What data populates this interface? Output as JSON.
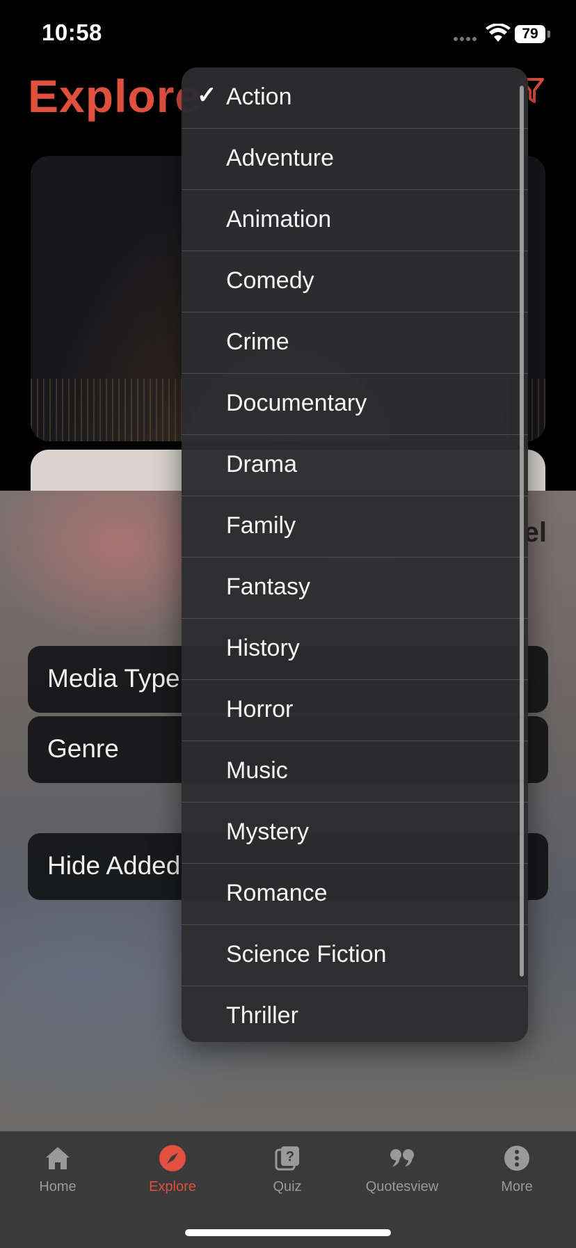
{
  "status_bar": {
    "time": "10:58",
    "battery": "79"
  },
  "page": {
    "title": "Explore"
  },
  "sheet": {
    "cancel_label": "el",
    "rows": {
      "media_type": "Media Type",
      "genre": "Genre",
      "hide_added": "Hide Added"
    }
  },
  "dropdown": {
    "selected": "Action",
    "check_glyph": "✓",
    "items": [
      "Action",
      "Adventure",
      "Animation",
      "Comedy",
      "Crime",
      "Documentary",
      "Drama",
      "Family",
      "Fantasy",
      "History",
      "Horror",
      "Music",
      "Mystery",
      "Romance",
      "Science Fiction",
      "Thriller"
    ]
  },
  "tab_bar": {
    "tabs": [
      {
        "label": "Home",
        "icon": "house-icon",
        "active": false
      },
      {
        "label": "Explore",
        "icon": "compass-icon",
        "active": true
      },
      {
        "label": "Quiz",
        "icon": "question-cards-icon",
        "active": false
      },
      {
        "label": "Quotesview",
        "icon": "quote-icon",
        "active": false
      },
      {
        "label": "More",
        "icon": "more-circle-icon",
        "active": false
      }
    ]
  },
  "colors": {
    "accent": "#e0503f",
    "tab_inactive": "#9a9a9a"
  }
}
